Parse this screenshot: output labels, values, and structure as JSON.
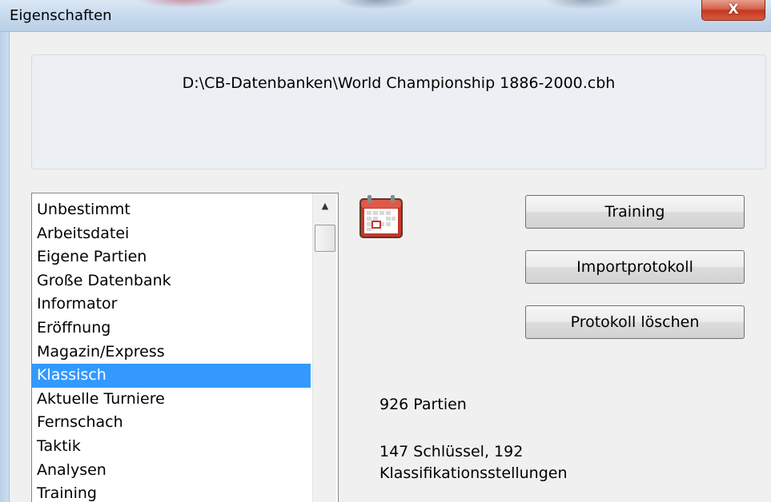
{
  "window": {
    "title": "Eigenschaften",
    "close_label": "X"
  },
  "path": "D:\\CB-Datenbanken\\World Championship 1886-2000.cbh",
  "types_list": {
    "items": [
      "Unbestimmt",
      "Arbeitsdatei",
      "Eigene Partien",
      "Große Datenbank",
      "Informator",
      "Eröffnung",
      "Magazin/Express",
      "Klassisch",
      "Aktuelle Turniere",
      "Fernschach",
      "Taktik",
      "Analysen",
      "Training"
    ],
    "selected": "Klassisch",
    "scroll_up_glyph": "▲"
  },
  "icon": "calendar-icon",
  "buttons": {
    "training": "Training",
    "import_log": "Importprotokoll",
    "delete_log": "Protokoll löschen"
  },
  "info": {
    "games": "926 Partien",
    "keys_line1": "147 Schlüssel, 192",
    "keys_line2": "Klassifikationsstellungen"
  },
  "colors": {
    "selection": "#3399ff",
    "close_button": "#c4391f",
    "calendar_red": "#c8362a"
  }
}
